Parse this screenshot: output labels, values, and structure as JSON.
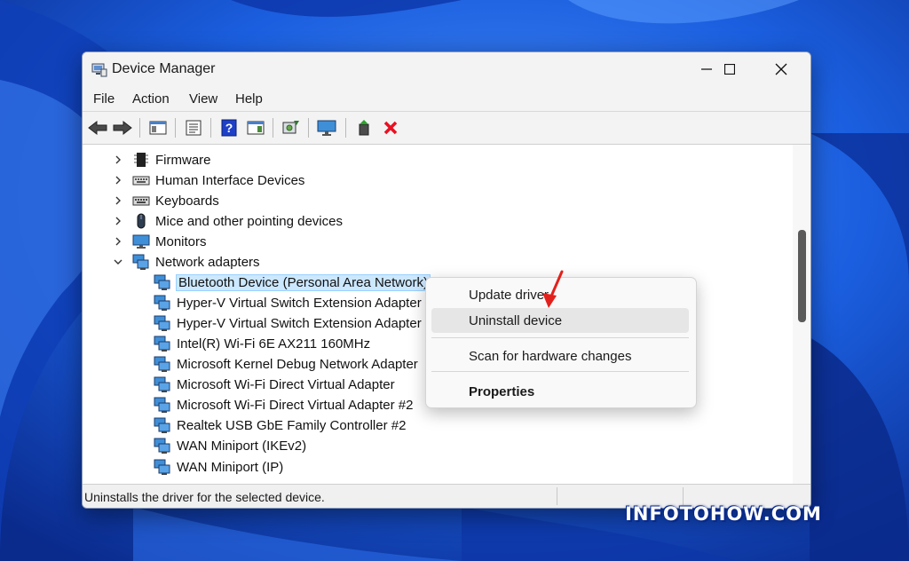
{
  "window": {
    "title": "Device Manager"
  },
  "menu": [
    "File",
    "Action",
    "View",
    "Help"
  ],
  "toolbar": {
    "icons": [
      "back-arrow-icon",
      "forward-arrow-icon",
      "show-hide-console-tree-icon",
      "properties-icon",
      "help-icon",
      "show-action-pane-icon",
      "scan-hardware-changes-icon",
      "display-monitor-icon",
      "enable-device-icon",
      "uninstall-device-x-icon"
    ]
  },
  "tree": {
    "categories": [
      {
        "label": "Firmware",
        "icon": "firmware-chip-icon",
        "expanded": false
      },
      {
        "label": "Human Interface Devices",
        "icon": "hid-keyboard-icon",
        "expanded": false
      },
      {
        "label": "Keyboards",
        "icon": "keyboard-icon",
        "expanded": false
      },
      {
        "label": "Mice and other pointing devices",
        "icon": "mouse-icon",
        "expanded": false
      },
      {
        "label": "Monitors",
        "icon": "monitor-icon",
        "expanded": false
      },
      {
        "label": "Network adapters",
        "icon": "network-adapter-icon",
        "expanded": true
      }
    ],
    "network_devices": [
      "Bluetooth Device (Personal Area Network)",
      "Hyper-V Virtual Switch Extension Adapter",
      "Hyper-V Virtual Switch Extension Adapter",
      "Intel(R) Wi-Fi 6E AX211 160MHz",
      "Microsoft Kernel Debug Network Adapter",
      "Microsoft Wi-Fi Direct Virtual Adapter",
      "Microsoft Wi-Fi Direct Virtual Adapter #2",
      "Realtek USB GbE Family Controller #2",
      "WAN Miniport (IKEv2)",
      "WAN Miniport (IP)"
    ],
    "selected_device": "Bluetooth Device (Personal Area Network)"
  },
  "context_menu": {
    "items": [
      "Update driver",
      "Uninstall device",
      "Scan for hardware changes",
      "Properties"
    ],
    "hovered": "Uninstall device"
  },
  "status": {
    "text": "Uninstalls the driver for the selected device."
  },
  "watermark": "INFOTOHOW.COM",
  "colors": {
    "selection": "#cce8ff",
    "menu_hover": "#e6e6e6",
    "uninstall_x": "#e81123",
    "annotation_arrow": "#e3211c"
  }
}
